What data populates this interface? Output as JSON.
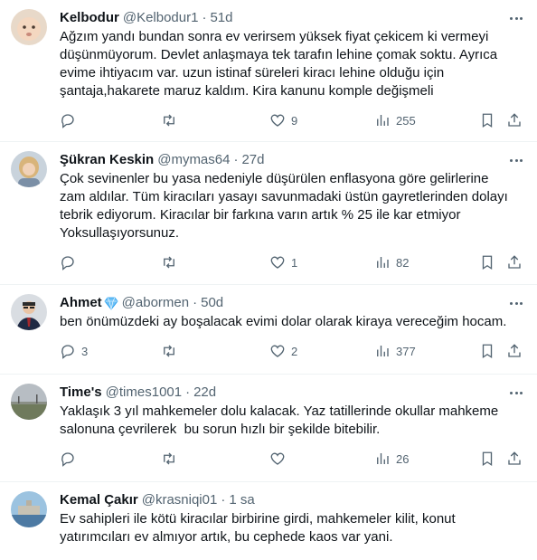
{
  "tweets": [
    {
      "name": "Kelbodur",
      "handle": "@Kelbodur1",
      "time": "51d",
      "text": "Ağzım yandı bundan sonra ev verirsem yüksek fiyat çekicem ki vermeyi\ndüşünmüyorum. Devlet anlaşmaya tek tarafın lehine çomak soktu. Ayrıca\nevime ihtiyacım var. uzun istinaf süreleri kiracı lehine olduğu için\nşantaja,hakarete maruz kaldım. Kira kanunu komple değişmeli",
      "replies": "",
      "retweets": "",
      "likes": "9",
      "views": "255"
    },
    {
      "name": "Şükran Keskin",
      "handle": "@mymas64",
      "time": "27d",
      "text": "Çok sevinenler bu yasa nedeniyle düşürülen enflasyona göre gelirlerine\nzam aldılar. Tüm kiracıları yasayı savunmadaki üstün gayretlerinden dolayı\ntebrik ediyorum. Kiracılar bir farkına varın artık % 25 ile kar etmiyor\nYoksullaşıyorsunuz.",
      "replies": "",
      "retweets": "",
      "likes": "1",
      "views": "82"
    },
    {
      "name": "Ahmet",
      "handle": "@abormen",
      "time": "50d",
      "text": "ben önümüzdeki ay boşalacak evimi dolar olarak kiraya vereceğim hocam.",
      "replies": "3",
      "retweets": "",
      "likes": "2",
      "views": "377"
    },
    {
      "name": "Time's",
      "handle": "@times1001",
      "time": "22d",
      "text": "Yaklaşık 3 yıl mahkemeler dolu kalacak. Yaz tatillerinde okullar mahkeme\nsalonuna çevrilerek  bu sorun hızlı bir şekilde bitebilir.",
      "replies": "",
      "retweets": "",
      "likes": "",
      "views": "26"
    },
    {
      "name": "Kemal Çakır",
      "handle": "@krasniqi01",
      "time": "1 sa",
      "text": "Ev sahipleri ile kötü kiracılar birbirine girdi, mahkemeler kilit, konut\nyatırımcıları ev almıyor artık, bu cephede kaos var yani.",
      "replies": "",
      "retweets": "",
      "likes": "",
      "views": ""
    }
  ],
  "separator": "·",
  "colors": {
    "text": "#0f1419",
    "muted": "#536471",
    "divider": "#eff3f4",
    "verified": "#1d9bf0"
  }
}
